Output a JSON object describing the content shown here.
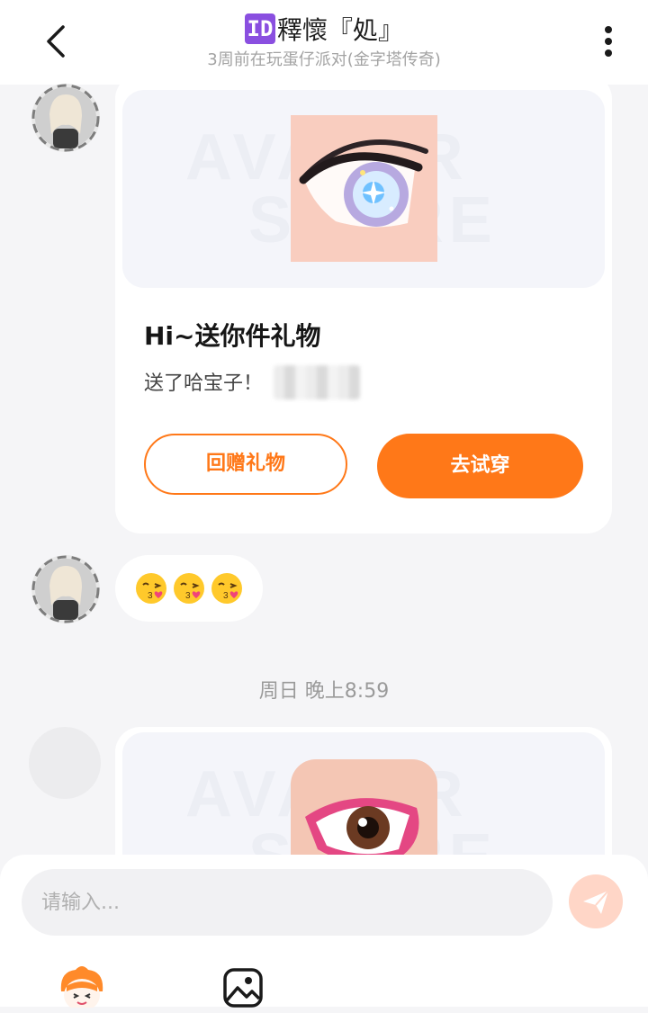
{
  "header": {
    "id_badge": "ID",
    "title": "釋懷『処』",
    "subtitle": "3周前在玩蛋仔派对(金字塔传奇)"
  },
  "messages": {
    "gift_card": {
      "watermark_line1": "AVATAR",
      "watermark_line2": "STORE",
      "title": "Hi~送你件礼物",
      "description": "送了哈宝子！",
      "return_gift_label": "回赠礼物",
      "try_on_label": "去试穿"
    },
    "emoji_message": [
      "😘",
      "😘",
      "😘"
    ],
    "timestamp": "周日 晚上8:59"
  },
  "composer": {
    "placeholder": "请输入..."
  },
  "colors": {
    "accent": "#ff7818",
    "id_badge": "#8a4fe0",
    "send_button": "#ffd6c7"
  },
  "icons": {
    "back": "chevron-left-icon",
    "more": "vertical-dots-icon",
    "send": "paper-plane-icon",
    "mascot": "eggy-mascot-icon",
    "image": "image-icon"
  }
}
